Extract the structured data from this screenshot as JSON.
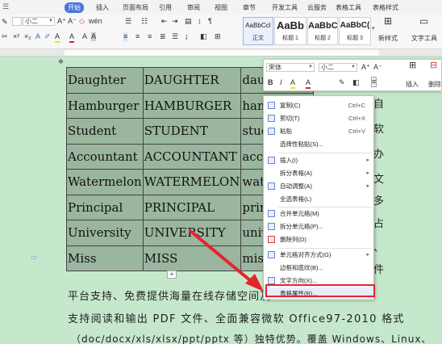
{
  "ribbon_tabs": [
    "开始",
    "插入",
    "页面布局",
    "引用",
    "审阅",
    "视图",
    "章节",
    "开发工具",
    "云服务",
    "表格工具",
    "表格样式"
  ],
  "ribbon": {
    "font_name": "",
    "font_size": "小二",
    "styles": [
      {
        "sample": "AaBbCcI",
        "name": "正文"
      },
      {
        "sample": "AaBb",
        "name": "标题 1"
      },
      {
        "sample": "AaBbC",
        "name": "标题 2"
      },
      {
        "sample": "AaBbC(",
        "name": "标题 3"
      }
    ],
    "new_style": "新样式",
    "text_tools": "文字工具"
  },
  "mini_toolbar": {
    "font": "宋体",
    "size": "小二",
    "insert": "插入",
    "delete": "删除"
  },
  "table": [
    [
      "Daughter",
      "DAUGHTER",
      "daughter"
    ],
    [
      "Hamburger",
      "HAMBURGER",
      "hamburge"
    ],
    [
      "Student",
      "STUDENT",
      "student"
    ],
    [
      "Accountant",
      "ACCOUNTANT",
      "accounta"
    ],
    [
      "Watermelon",
      "WATERMELON",
      "watermel"
    ],
    [
      "Principal",
      "PRINCIPAL",
      "principa"
    ],
    [
      "University",
      "UNIVERSITY",
      "universi"
    ],
    [
      "Miss",
      "MISS",
      "miss"
    ]
  ],
  "body_text": {
    "line1": "平台支持、免费提供海量在线存储空间及",
    "line2": "支持阅读和输出 PDF 文件、全面兼容微软 Office97-2010 格式",
    "line3": "（doc/docx/xls/xlsx/ppt/pptx 等）独特优势。覆盖 Windows、Linux、",
    "vertical_chars": [
      "自",
      "软",
      "办",
      "文",
      "多",
      "占",
      "、",
      "件"
    ]
  },
  "context_menu": {
    "items": [
      {
        "label": "复制(C)",
        "shortcut": "Ctrl+C"
      },
      {
        "label": "剪切(T)",
        "shortcut": "Ctrl+X"
      },
      {
        "label": "粘贴",
        "shortcut": "Ctrl+V"
      },
      {
        "label": "选择性粘贴(S)..."
      },
      {
        "label": "插入(I)"
      },
      {
        "label": "拆分表格(A)"
      },
      {
        "label": "自动调整(A)"
      },
      {
        "label": "全选表格(L)"
      },
      {
        "label": "合并单元格(M)"
      },
      {
        "label": "拆分单元格(P)..."
      },
      {
        "label": "删除列(D)"
      },
      {
        "label": "单元格对齐方式(G)"
      },
      {
        "label": "边框和底纹(B)..."
      },
      {
        "label": "文字方向(X)..."
      },
      {
        "label": "表格属性(R)..."
      }
    ],
    "highlighted": "表格属性(R)..."
  },
  "colors": {
    "accent": "#4a74d9",
    "page": "#c5e8cc",
    "table_cell": "#9ab69e",
    "highlight": "#e3262e"
  }
}
